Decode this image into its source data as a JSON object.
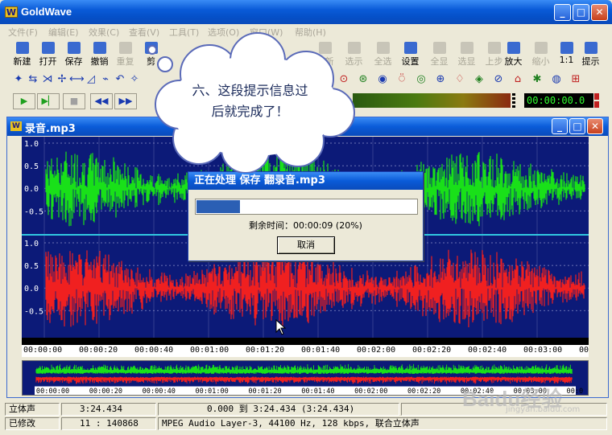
{
  "app": {
    "title": "GoldWave",
    "icon_letter": "W"
  },
  "menu": [
    "文件(F)",
    "编辑(E)",
    "效果(C)",
    "查看(V)",
    "工具(T)",
    "选项(O)",
    "窗口(W)",
    "帮助(H)"
  ],
  "toolbar": {
    "left": [
      {
        "label": "新建",
        "icon": "new-icon"
      },
      {
        "label": "打开",
        "icon": "open-icon"
      },
      {
        "label": "保存",
        "icon": "save-icon"
      },
      {
        "label": "撤销",
        "icon": "undo-icon"
      },
      {
        "label": "重复",
        "icon": "redo-icon",
        "disabled": true
      },
      {
        "label": "剪",
        "icon": "cut-icon"
      }
    ],
    "right": [
      {
        "label": "粘新",
        "icon": "paste-new-icon",
        "disabled": true
      },
      {
        "label": "选示",
        "icon": "select-view-icon",
        "disabled": true
      },
      {
        "label": "全选",
        "icon": "select-all-icon",
        "disabled": true
      },
      {
        "label": "设置",
        "icon": "settings-icon"
      },
      {
        "label": "全显",
        "icon": "show-all-icon",
        "disabled": true
      },
      {
        "label": "选显",
        "icon": "show-selection-icon",
        "disabled": true
      },
      {
        "label": "上步",
        "icon": "previous-icon",
        "disabled": true
      },
      {
        "label": "放大",
        "icon": "zoom-in-icon"
      },
      {
        "label": "缩小",
        "icon": "zoom-out-icon",
        "disabled": true
      },
      {
        "label": "1:1",
        "icon": "zoom-1to1-icon"
      },
      {
        "label": "提示",
        "icon": "hint-icon"
      }
    ]
  },
  "transport": {
    "time": "00:00:00.0"
  },
  "child": {
    "title": "录音.mp3",
    "icon_letter": "W"
  },
  "waveform": {
    "y_ticks": [
      "1.0",
      "0.5",
      "0.0",
      "-0.5"
    ],
    "channel_colors": [
      "#19e019",
      "#f02020"
    ],
    "background": "#0c1a78"
  },
  "timeline": [
    "00:00:00",
    "00:00:20",
    "00:00:40",
    "00:01:00",
    "00:01:20",
    "00:01:40",
    "00:02:00",
    "00:02:20",
    "00:02:40",
    "00:03:00",
    "00:0"
  ],
  "overview_timeline": [
    "00:00:00",
    "00:00:20",
    "00:00:40",
    "00:01:00",
    "00:01:20",
    "00:01:40",
    "00:02:00",
    "00:02:20",
    "00:02:40",
    "00:03:00",
    "00:0"
  ],
  "status": {
    "row1": [
      "立体声",
      "3:24.434",
      "0.000 到 3:24.434 (3:24.434)"
    ],
    "row2": [
      "已修改",
      "11 : 140868",
      "MPEG Audio Layer-3, 44100 Hz, 128 kbps, 联合立体声"
    ]
  },
  "dialog": {
    "title": "正在处理 保存 翻录音.mp3",
    "remaining_text": "剩余时间：00:00:09 (20%)",
    "progress": 0.2,
    "cancel_label": "取消"
  },
  "callout": {
    "line1": "六、这段提示信息过",
    "line2": "后就完成了！"
  },
  "watermark": {
    "brand": "Baidu经验",
    "url": "jingyan.baidu.com"
  }
}
